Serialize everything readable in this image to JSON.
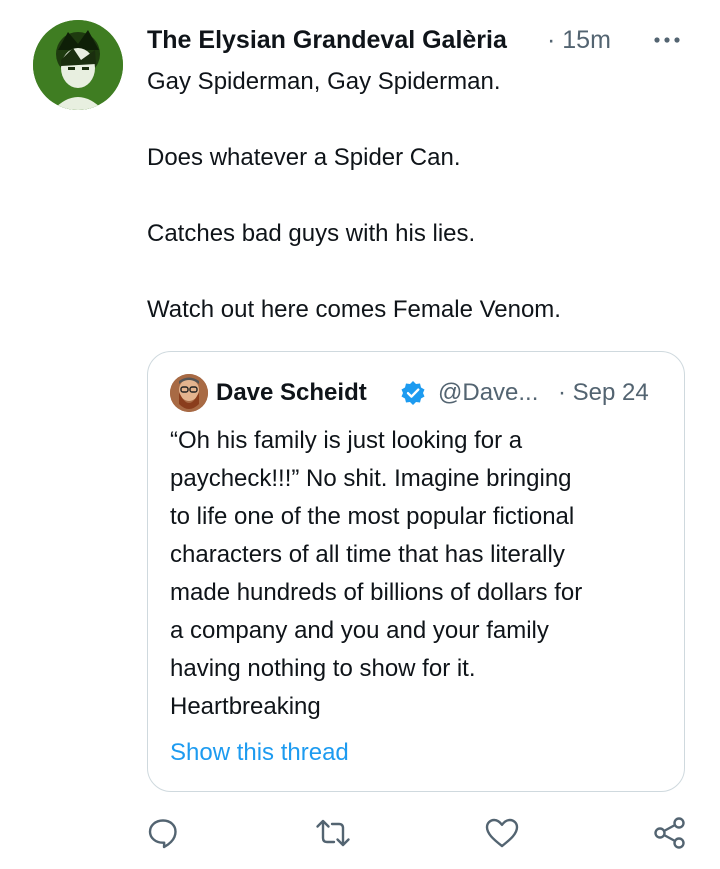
{
  "tweet": {
    "author_name": "The Elysian Grandeval Galèria",
    "time": "· 15m",
    "text_lines": [
      "Gay Spiderman, Gay Spiderman.",
      "",
      "Does whatever a Spider Can.",
      "",
      "Catches bad guys with his lies.",
      "",
      "Watch out here comes Female Venom."
    ]
  },
  "quote": {
    "name": "Dave Scheidt",
    "handle": "@Dave...",
    "date": "· Sep 24",
    "text_lines": [
      "“Oh his family is just looking for a",
      "paycheck!!!” No shit. Imagine bringing",
      "to life one of the most popular fictional",
      "characters of all time that has literally",
      "made hundreds of billions of dollars for",
      "a company and you and your family",
      "having nothing to show for it.",
      "Heartbreaking"
    ],
    "show_thread": "Show this thread"
  },
  "icons": {
    "more": "more-icon",
    "reply": "reply-icon",
    "retweet": "retweet-icon",
    "like": "like-icon",
    "share": "share-icon",
    "verified": "verified-badge-icon"
  },
  "colors": {
    "accent": "#1d9bf0",
    "secondary_text": "#536471",
    "border": "#cfd9de"
  }
}
